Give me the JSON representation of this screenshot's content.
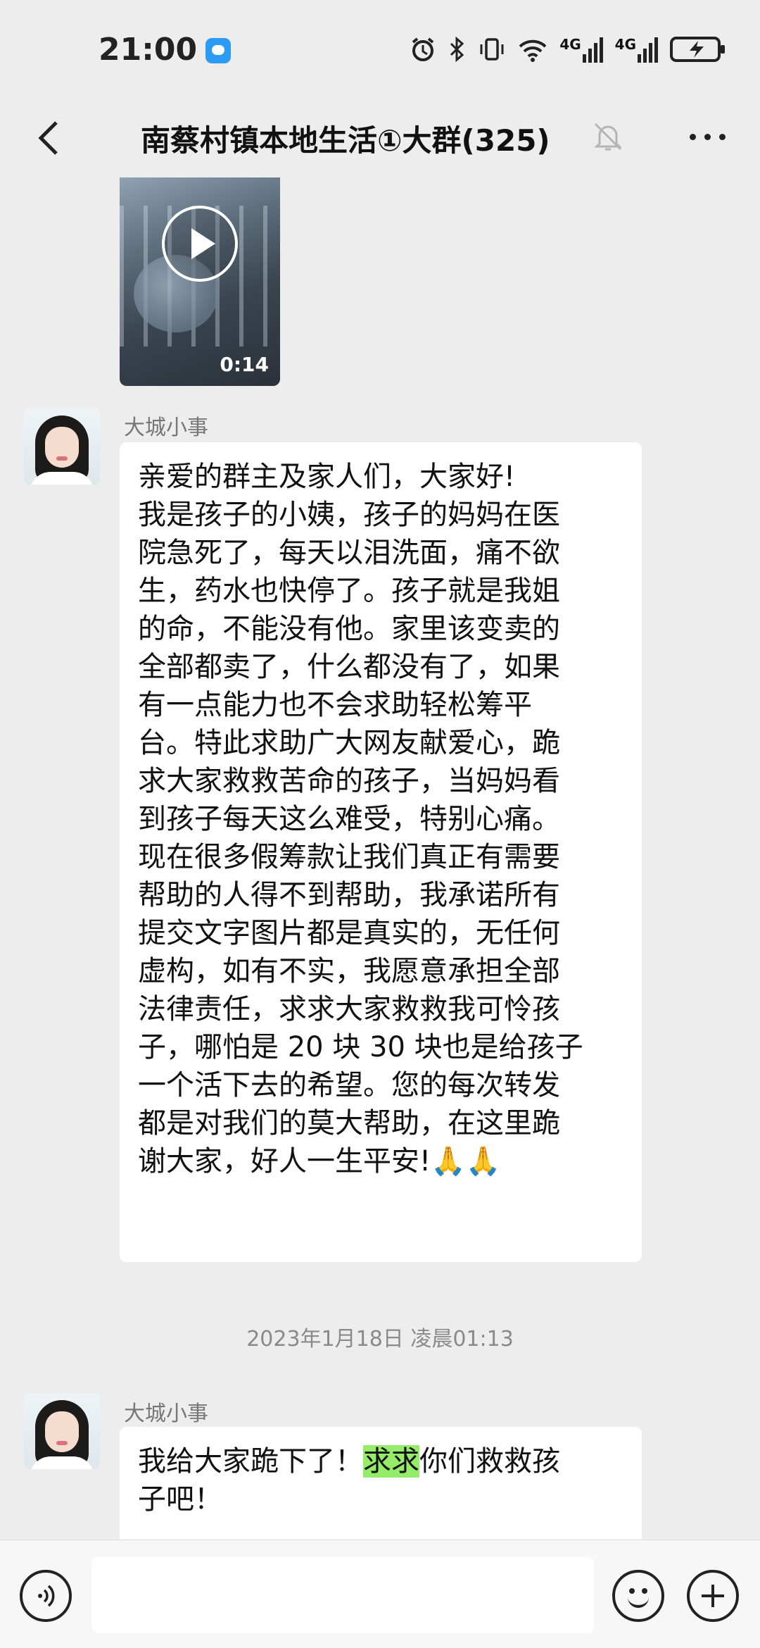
{
  "status_bar": {
    "time": "21:00",
    "network_1": "4G",
    "network_2": "4G"
  },
  "header": {
    "title": "南蔡村镇本地生活①大群(325)",
    "back_icon": "chevron-left-icon",
    "mute_icon": "bell-muted-icon",
    "more_icon": "more-dots-icon"
  },
  "messages": {
    "video": {
      "duration": "0:14"
    },
    "msg1": {
      "sender": "大城小事",
      "lines": [
        "亲爱的群主及家人们，大家好!",
        "我是孩子的小姨，孩子的妈妈在医",
        "院急死了，每天以泪洗面，痛不欲",
        "生，药水也快停了。孩子就是我姐",
        "的命，不能没有他。家里该变卖的",
        "全部都卖了，什么都没有了，如果",
        "有一点能力也不会求助轻松筹平",
        "台。特此求助广大网友献爱心，跪",
        "求大家救救苦命的孩子，当妈妈看",
        "到孩子每天这么难受，特别心痛。",
        "现在很多假筹款让我们真正有需要",
        "帮助的人得不到帮助，我承诺所有",
        "提交文字图片都是真实的，无任何",
        "虚构，如有不实，我愿意承担全部",
        "法律责任，求求大家救救我可怜孩",
        "子，哪怕是 20 块 30 块也是给孩子",
        "一个活下去的希望。您的每次转发",
        "都是对我们的莫大帮助，在这里跪",
        "谢大家，好人一生平安!🙏🙏"
      ]
    },
    "timestamp": "2023年1月18日 凌晨01:13",
    "msg2": {
      "sender": "大城小事",
      "line1_before": "我给大家跪下了！",
      "line1_highlight": "求求",
      "line1_after": "你们救救孩",
      "line2": "子吧！"
    }
  },
  "input_bar": {
    "voice_icon": "voice-icon",
    "emoji_icon": "emoji-icon",
    "plus_icon": "plus-icon",
    "placeholder": ""
  }
}
